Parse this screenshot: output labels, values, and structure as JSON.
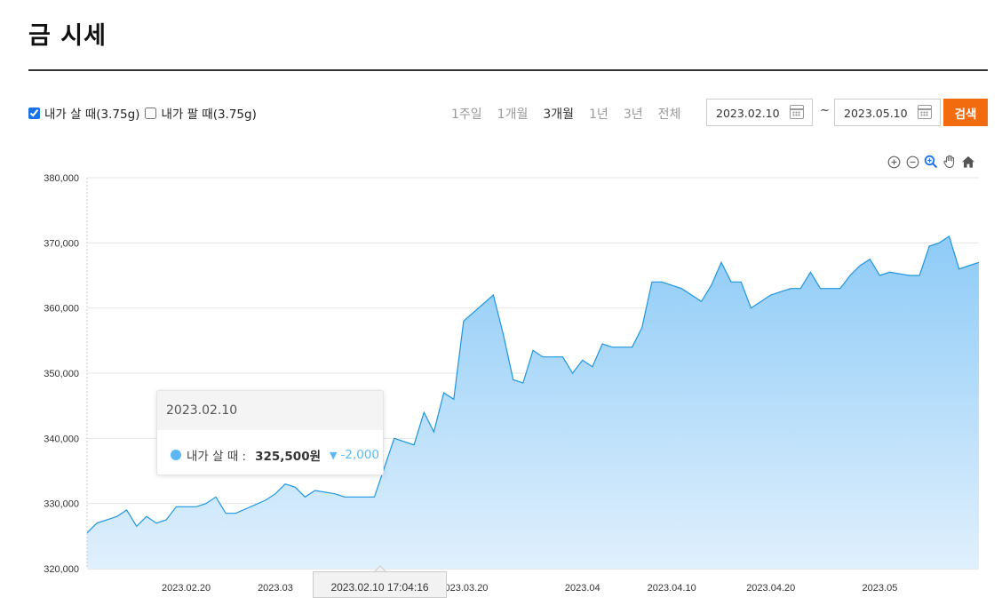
{
  "page": {
    "title": "금 시세"
  },
  "options": {
    "buy_label": "내가 살 때(3.75g)",
    "buy_checked": true,
    "sell_label": "내가 팔 때(3.75g)",
    "sell_checked": false
  },
  "periods": [
    {
      "label": "1주일",
      "active": false
    },
    {
      "label": "1개월",
      "active": false
    },
    {
      "label": "3개월",
      "active": true
    },
    {
      "label": "1년",
      "active": false
    },
    {
      "label": "3년",
      "active": false
    },
    {
      "label": "전체",
      "active": false
    }
  ],
  "date_range": {
    "start": "2023.02.10",
    "separator": "~",
    "end": "2023.05.10"
  },
  "search_button": "검색",
  "tools": [
    "zoom-in-icon",
    "zoom-out-icon",
    "magnify-icon",
    "pan-hand-icon",
    "home-icon"
  ],
  "tooltip": {
    "date": "2023.02.10",
    "label": "내가 살 때 :",
    "value": "325,500원",
    "change": "-2,000"
  },
  "crosshair_label": "2023.02.10 17:04:16",
  "colors": {
    "accent": "#f26b0f",
    "line": "#1e96e0",
    "fill_top": "#8ecbf7",
    "fill_bottom": "#e0f0fd"
  },
  "chart_data": {
    "type": "area",
    "series": [
      {
        "name": "내가 살 때"
      }
    ],
    "x_start": "2023-02-10",
    "x_end": "2023-05-10",
    "ylim": [
      320000,
      380000
    ],
    "yticks": [
      "320,000",
      "330,000",
      "340,000",
      "350,000",
      "360,000",
      "370,000",
      "380,000"
    ],
    "xticks": [
      {
        "label": "2023.02.20",
        "date": "2023-02-20"
      },
      {
        "label": "2023.03",
        "date": "2023-03-01"
      },
      {
        "label": "2023.03.20",
        "date": "2023-03-20"
      },
      {
        "label": "2023.04",
        "date": "2023-04-01"
      },
      {
        "label": "2023.04.10",
        "date": "2023-04-10"
      },
      {
        "label": "2023.04.20",
        "date": "2023-04-20"
      },
      {
        "label": "2023.05",
        "date": "2023-05-01"
      }
    ],
    "grid": true,
    "points": [
      [
        "2023-02-10",
        325500
      ],
      [
        "2023-02-11",
        327000
      ],
      [
        "2023-02-13",
        328000
      ],
      [
        "2023-02-14",
        329000
      ],
      [
        "2023-02-15",
        326500
      ],
      [
        "2023-02-16",
        328000
      ],
      [
        "2023-02-17",
        327000
      ],
      [
        "2023-02-18",
        327500
      ],
      [
        "2023-02-19",
        329500
      ],
      [
        "2023-02-21",
        329500
      ],
      [
        "2023-02-22",
        330000
      ],
      [
        "2023-02-23",
        331000
      ],
      [
        "2023-02-24",
        328500
      ],
      [
        "2023-02-25",
        328500
      ],
      [
        "2023-02-28",
        330500
      ],
      [
        "2023-03-01",
        331500
      ],
      [
        "2023-03-02",
        333000
      ],
      [
        "2023-03-03",
        332500
      ],
      [
        "2023-03-04",
        331000
      ],
      [
        "2023-03-05",
        332000
      ],
      [
        "2023-03-07",
        331500
      ],
      [
        "2023-03-08",
        331000
      ],
      [
        "2023-03-10",
        331000
      ],
      [
        "2023-03-11",
        331000
      ],
      [
        "2023-03-13",
        340000
      ],
      [
        "2023-03-15",
        339000
      ],
      [
        "2023-03-16",
        344000
      ],
      [
        "2023-03-17",
        341000
      ],
      [
        "2023-03-18",
        347000
      ],
      [
        "2023-03-19",
        346000
      ],
      [
        "2023-03-20",
        358000
      ],
      [
        "2023-03-23",
        362000
      ],
      [
        "2023-03-24",
        356000
      ],
      [
        "2023-03-25",
        349000
      ],
      [
        "2023-03-26",
        348500
      ],
      [
        "2023-03-27",
        353500
      ],
      [
        "2023-03-28",
        352500
      ],
      [
        "2023-03-30",
        352500
      ],
      [
        "2023-03-31",
        350000
      ],
      [
        "2023-04-01",
        352000
      ],
      [
        "2023-04-02",
        351000
      ],
      [
        "2023-04-03",
        354500
      ],
      [
        "2023-04-04",
        354000
      ],
      [
        "2023-04-06",
        354000
      ],
      [
        "2023-04-07",
        357000
      ],
      [
        "2023-04-08",
        364000
      ],
      [
        "2023-04-09",
        364000
      ],
      [
        "2023-04-11",
        363000
      ],
      [
        "2023-04-13",
        361000
      ],
      [
        "2023-04-14",
        363500
      ],
      [
        "2023-04-15",
        367000
      ],
      [
        "2023-04-16",
        364000
      ],
      [
        "2023-04-17",
        364000
      ],
      [
        "2023-04-18",
        360000
      ],
      [
        "2023-04-20",
        362000
      ],
      [
        "2023-04-21",
        362500
      ],
      [
        "2023-04-22",
        363000
      ],
      [
        "2023-04-23",
        363000
      ],
      [
        "2023-04-24",
        365500
      ],
      [
        "2023-04-25",
        363000
      ],
      [
        "2023-04-27",
        363000
      ],
      [
        "2023-04-28",
        365000
      ],
      [
        "2023-04-29",
        366500
      ],
      [
        "2023-04-30",
        367500
      ],
      [
        "2023-05-01",
        365000
      ],
      [
        "2023-05-02",
        365500
      ],
      [
        "2023-05-04",
        365000
      ],
      [
        "2023-05-05",
        365000
      ],
      [
        "2023-05-06",
        369500
      ],
      [
        "2023-05-07",
        370000
      ],
      [
        "2023-05-08",
        371000
      ],
      [
        "2023-05-09",
        366000
      ],
      [
        "2023-05-10",
        366500
      ],
      [
        "2023-05-11",
        367000
      ]
    ]
  }
}
